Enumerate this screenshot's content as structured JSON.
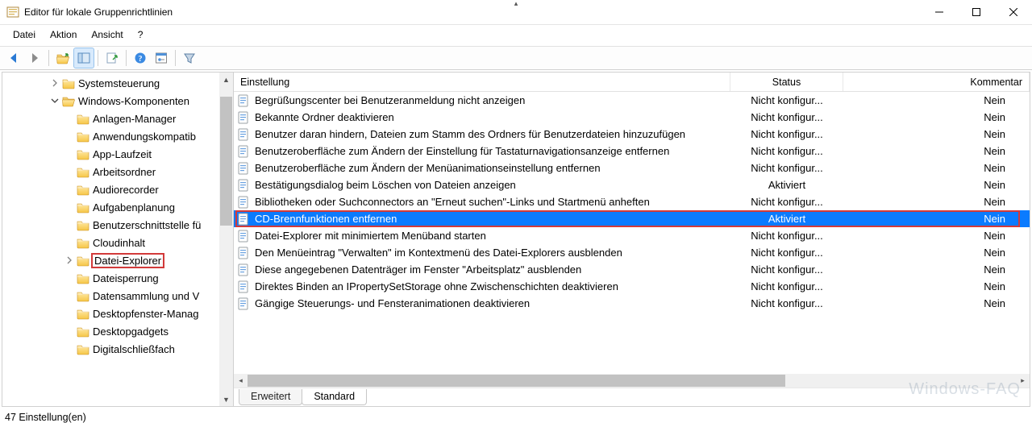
{
  "window": {
    "title": "Editor für lokale Gruppenrichtlinien"
  },
  "menu": {
    "file": "Datei",
    "action": "Aktion",
    "view": "Ansicht",
    "help": "?"
  },
  "tree": {
    "items": [
      {
        "level": 3,
        "expander": "right",
        "label": "Systemsteuerung"
      },
      {
        "level": 3,
        "expander": "down",
        "label": "Windows-Komponenten"
      },
      {
        "level": 4,
        "expander": "",
        "label": "Anlagen-Manager"
      },
      {
        "level": 4,
        "expander": "",
        "label": "Anwendungskompatib"
      },
      {
        "level": 4,
        "expander": "",
        "label": "App-Laufzeit"
      },
      {
        "level": 4,
        "expander": "",
        "label": "Arbeitsordner"
      },
      {
        "level": 4,
        "expander": "",
        "label": "Audiorecorder"
      },
      {
        "level": 4,
        "expander": "",
        "label": "Aufgabenplanung"
      },
      {
        "level": 4,
        "expander": "",
        "label": "Benutzerschnittstelle fü"
      },
      {
        "level": 4,
        "expander": "",
        "label": "Cloudinhalt"
      },
      {
        "level": 4,
        "expander": "right",
        "label": "Datei-Explorer",
        "highlight": true
      },
      {
        "level": 4,
        "expander": "",
        "label": "Dateisperrung"
      },
      {
        "level": 4,
        "expander": "",
        "label": "Datensammlung und V"
      },
      {
        "level": 4,
        "expander": "",
        "label": "Desktopfenster-Manag"
      },
      {
        "level": 4,
        "expander": "",
        "label": "Desktopgadgets"
      },
      {
        "level": 4,
        "expander": "",
        "label": "Digitalschließfach"
      }
    ]
  },
  "columns": {
    "setting": "Einstellung",
    "status": "Status",
    "comment": "Kommentar"
  },
  "rows": [
    {
      "label": "Begrüßungscenter bei Benutzeranmeldung nicht anzeigen",
      "status": "Nicht konfigur...",
      "comment": "Nein"
    },
    {
      "label": "Bekannte Ordner deaktivieren",
      "status": "Nicht konfigur...",
      "comment": "Nein"
    },
    {
      "label": "Benutzer daran hindern, Dateien zum Stamm des Ordners für Benutzerdateien hinzuzufügen",
      "status": "Nicht konfigur...",
      "comment": "Nein"
    },
    {
      "label": "Benutzeroberfläche zum Ändern der Einstellung für Tastaturnavigationsanzeige entfernen",
      "status": "Nicht konfigur...",
      "comment": "Nein"
    },
    {
      "label": "Benutzeroberfläche zum Ändern der Menüanimationseinstellung entfernen",
      "status": "Nicht konfigur...",
      "comment": "Nein"
    },
    {
      "label": "Bestätigungsdialog beim Löschen von Dateien anzeigen",
      "status": "Aktiviert",
      "comment": "Nein"
    },
    {
      "label": "Bibliotheken oder Suchconnectors an \"Erneut suchen\"-Links und Startmenü anheften",
      "status": "Nicht konfigur...",
      "comment": "Nein"
    },
    {
      "label": "CD-Brennfunktionen entfernen",
      "status": "Aktiviert",
      "comment": "Nein",
      "selected": true
    },
    {
      "label": "Datei-Explorer mit minimiertem Menüband starten",
      "status": "Nicht konfigur...",
      "comment": "Nein"
    },
    {
      "label": "Den Menüeintrag \"Verwalten\" im Kontextmenü des Datei-Explorers ausblenden",
      "status": "Nicht konfigur...",
      "comment": "Nein"
    },
    {
      "label": "Diese angegebenen Datenträger im Fenster \"Arbeitsplatz\" ausblenden",
      "status": "Nicht konfigur...",
      "comment": "Nein"
    },
    {
      "label": "Direktes Binden an IPropertySetStorage ohne Zwischenschichten deaktivieren",
      "status": "Nicht konfigur...",
      "comment": "Nein"
    },
    {
      "label": "Gängige Steuerungs- und Fensteranimationen deaktivieren",
      "status": "Nicht konfigur...",
      "comment": "Nein"
    }
  ],
  "tabs": {
    "extended": "Erweitert",
    "standard": "Standard"
  },
  "statusbar": {
    "text": "47 Einstellung(en)"
  },
  "watermark": "Windows-FAQ"
}
